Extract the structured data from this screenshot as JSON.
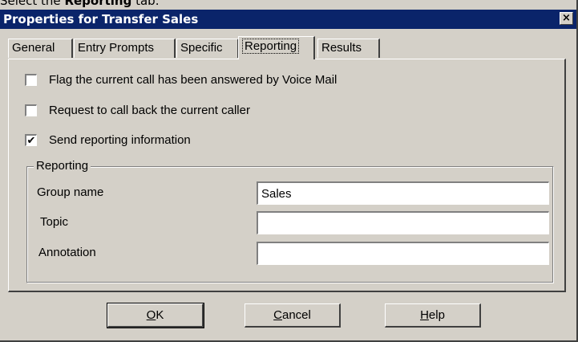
{
  "caption": {
    "prefix": "Select the ",
    "bold": "Reporting",
    "suffix": " tab."
  },
  "window": {
    "title": "Properties for Transfer Sales",
    "close_glyph": "×"
  },
  "tabs": [
    {
      "label": "General",
      "active": false
    },
    {
      "label": "Entry Prompts",
      "active": false
    },
    {
      "label": "Specific",
      "active": false
    },
    {
      "label": "Reporting",
      "active": true
    },
    {
      "label": "Results",
      "active": false
    }
  ],
  "options": {
    "voice_mail": {
      "label": "Flag the current call has been answered by Voice Mail",
      "checked": false
    },
    "call_back": {
      "label": "Request to call back the current caller",
      "checked": false
    },
    "send_reporting": {
      "label": "Send reporting information",
      "checked": true,
      "mark": "✔"
    }
  },
  "reporting": {
    "title": "Reporting",
    "group_name_label": "Group name",
    "group_name_value": "Sales",
    "topic_label": "Topic",
    "topic_value": "",
    "annotation_label": "Annotation",
    "annotation_value": ""
  },
  "buttons": {
    "ok": {
      "mnemonic": "O",
      "rest": "K"
    },
    "cancel": {
      "mnemonic": "C",
      "rest": "ancel"
    },
    "help": {
      "mnemonic": "H",
      "rest": "elp"
    }
  },
  "colors": {
    "titlebar": "#0a246a",
    "face": "#d4d0c8"
  },
  "icons": {
    "close": "close-icon",
    "checkmark": "checkmark-icon"
  }
}
